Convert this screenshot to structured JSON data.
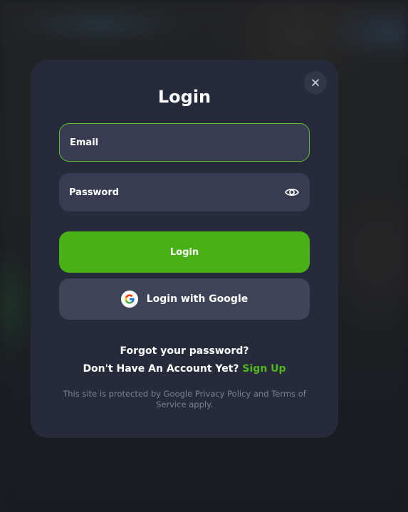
{
  "modal": {
    "title": "Login",
    "close_icon": "close-icon",
    "email": {
      "placeholder": "Email",
      "value": ""
    },
    "password": {
      "placeholder": "Password",
      "value": "",
      "toggle_icon": "eye-icon"
    },
    "login_button": "Login",
    "google_button": "Login with Google",
    "google_icon": "google-g-icon",
    "forgot_password": "Forgot your password?",
    "signup_prompt": "Don't Have An Account Yet?",
    "signup_link": "Sign Up",
    "recaptcha_notice": "This site is protected by Google Privacy Policy and Terms of Service apply."
  },
  "colors": {
    "accent": "#48b116",
    "link": "#4fb91d",
    "modal_bg": "#272a3a",
    "input_bg": "#383b52",
    "google_button_bg": "#404459"
  }
}
